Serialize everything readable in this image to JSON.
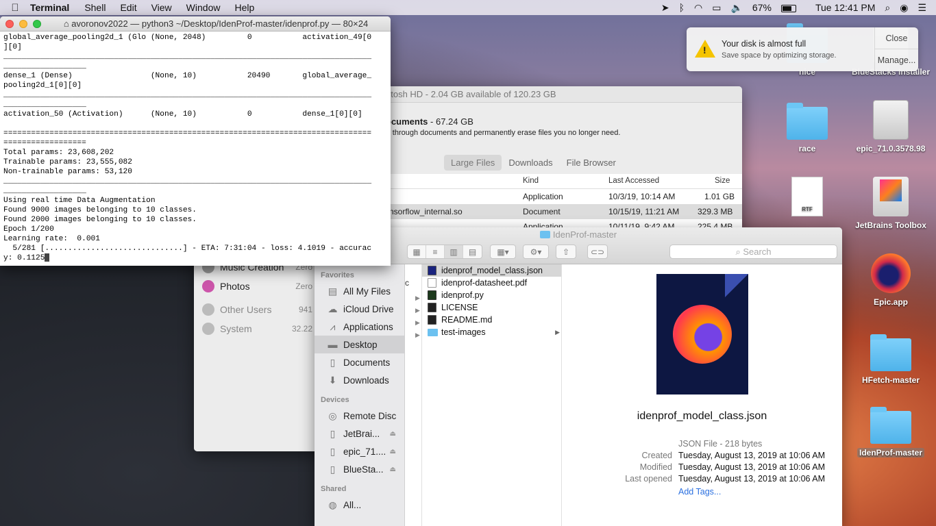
{
  "menubar": {
    "apple": "",
    "app_name": "Terminal",
    "items": [
      "Shell",
      "Edit",
      "View",
      "Window",
      "Help"
    ],
    "battery": "67%",
    "clock": "Tue 12:41 PM"
  },
  "terminal": {
    "title": "avoronov2022 — python3 ~/Desktop/IdenProf-master/idenprof.py — 80×24",
    "lines": [
      "global_average_pooling2d_1 (Glo (None, 2048)         0           activation_49[0",
      "][0]",
      "________________________________________________________________________________",
      "__________________",
      "dense_1 (Dense)                 (None, 10)           20490       global_average_",
      "pooling2d_1[0][0]",
      "________________________________________________________________________________",
      "__________________",
      "activation_50 (Activation)      (None, 10)           0           dense_1[0][0]",
      "",
      "================================================================================",
      "==================",
      "Total params: 23,608,202",
      "Trainable params: 23,555,082",
      "Non-trainable params: 53,120",
      "________________________________________________________________________________",
      "__________________",
      "Using real time Data Augmentation",
      "Found 9000 images belonging to 10 classes.",
      "Found 2000 images belonging to 10 classes.",
      "Epoch 1/200",
      "Learning rate:  0.001",
      "  5/281 [..............................] - ETA: 7:31:04 - loss: 4.1019 - accurac"
    ],
    "last_line": "y: 0.1125"
  },
  "storage": {
    "title": "ntosh HD - 2.04 GB available of 120.23 GB",
    "section_title": "ocuments",
    "section_size": " - 67.24 GB",
    "section_desc": "rt through documents and permanently erase files you no longer need.",
    "tabs": [
      "Large Files",
      "Downloads",
      "File Browser"
    ],
    "columns": {
      "kind": "Kind",
      "last_accessed": "Last Accessed",
      "size": "Size"
    },
    "rows": [
      {
        "name": "",
        "kind": "Application",
        "accessed": "10/3/19, 10:14 AM",
        "size": "1.01 GB"
      },
      {
        "name": "nsorflow_internal.so",
        "kind": "Document",
        "accessed": "10/15/19, 11:21 AM",
        "size": "329.3 MB"
      },
      {
        "name": "",
        "kind": "Application",
        "accessed": "10/11/19, 9:42 AM",
        "size": "225.4 MB"
      }
    ],
    "sidebar": [
      {
        "label": "Music Creation",
        "size": "Zero"
      },
      {
        "label": "Photos",
        "size": "Zero"
      },
      {
        "label": "Other Users",
        "size": "941"
      },
      {
        "label": "System",
        "size": "32.22"
      }
    ]
  },
  "finder": {
    "title": "IdenProf-master",
    "search_placeholder": "Search",
    "favorites_header": "Favorites",
    "favorites": [
      "All My Files",
      "iCloud Drive",
      "Applications",
      "Desktop",
      "Documents",
      "Downloads"
    ],
    "devices_header": "Devices",
    "devices": [
      "Remote Disc",
      "JetBrai...",
      "epic_71....",
      "BlueSta..."
    ],
    "shared_header": "Shared",
    "shared": [
      "All..."
    ],
    "col1_glyph": "c",
    "files": [
      {
        "name": "idenprof_model_class.json",
        "type": "json"
      },
      {
        "name": "idenprof-datasheet.pdf",
        "type": "pdf"
      },
      {
        "name": "idenprof.py",
        "type": "py"
      },
      {
        "name": "LICENSE",
        "type": "txt"
      },
      {
        "name": "README.md",
        "type": "txt"
      },
      {
        "name": "test-images",
        "type": "folder"
      }
    ],
    "preview": {
      "name": "idenprof_model_class.json",
      "kind": "JSON File - 218 bytes",
      "created_label": "Created",
      "created": "Tuesday, August 13, 2019 at 10:06 AM",
      "modified_label": "Modified",
      "modified": "Tuesday, August 13, 2019 at 10:06 AM",
      "opened_label": "Last opened",
      "opened": "Tuesday, August 13, 2019 at 10:06 AM",
      "tags": "Add Tags..."
    }
  },
  "notification": {
    "title": "Your disk is almost full",
    "subtitle": "Save space by optimizing storage.",
    "close": "Close",
    "manage": "Manage..."
  },
  "desktop": {
    "icons": [
      {
        "label": "nice"
      },
      {
        "label": "BlueStacks Installer"
      },
      {
        "label": "race"
      },
      {
        "label": "epic_71.0.3578.98"
      },
      {
        "label": "JetBrains Toolbox"
      },
      {
        "label": "Epic.app"
      },
      {
        "label": "HFetch-master"
      },
      {
        "label": "IdenProf-master"
      }
    ],
    "rtf_label": "RTF"
  }
}
